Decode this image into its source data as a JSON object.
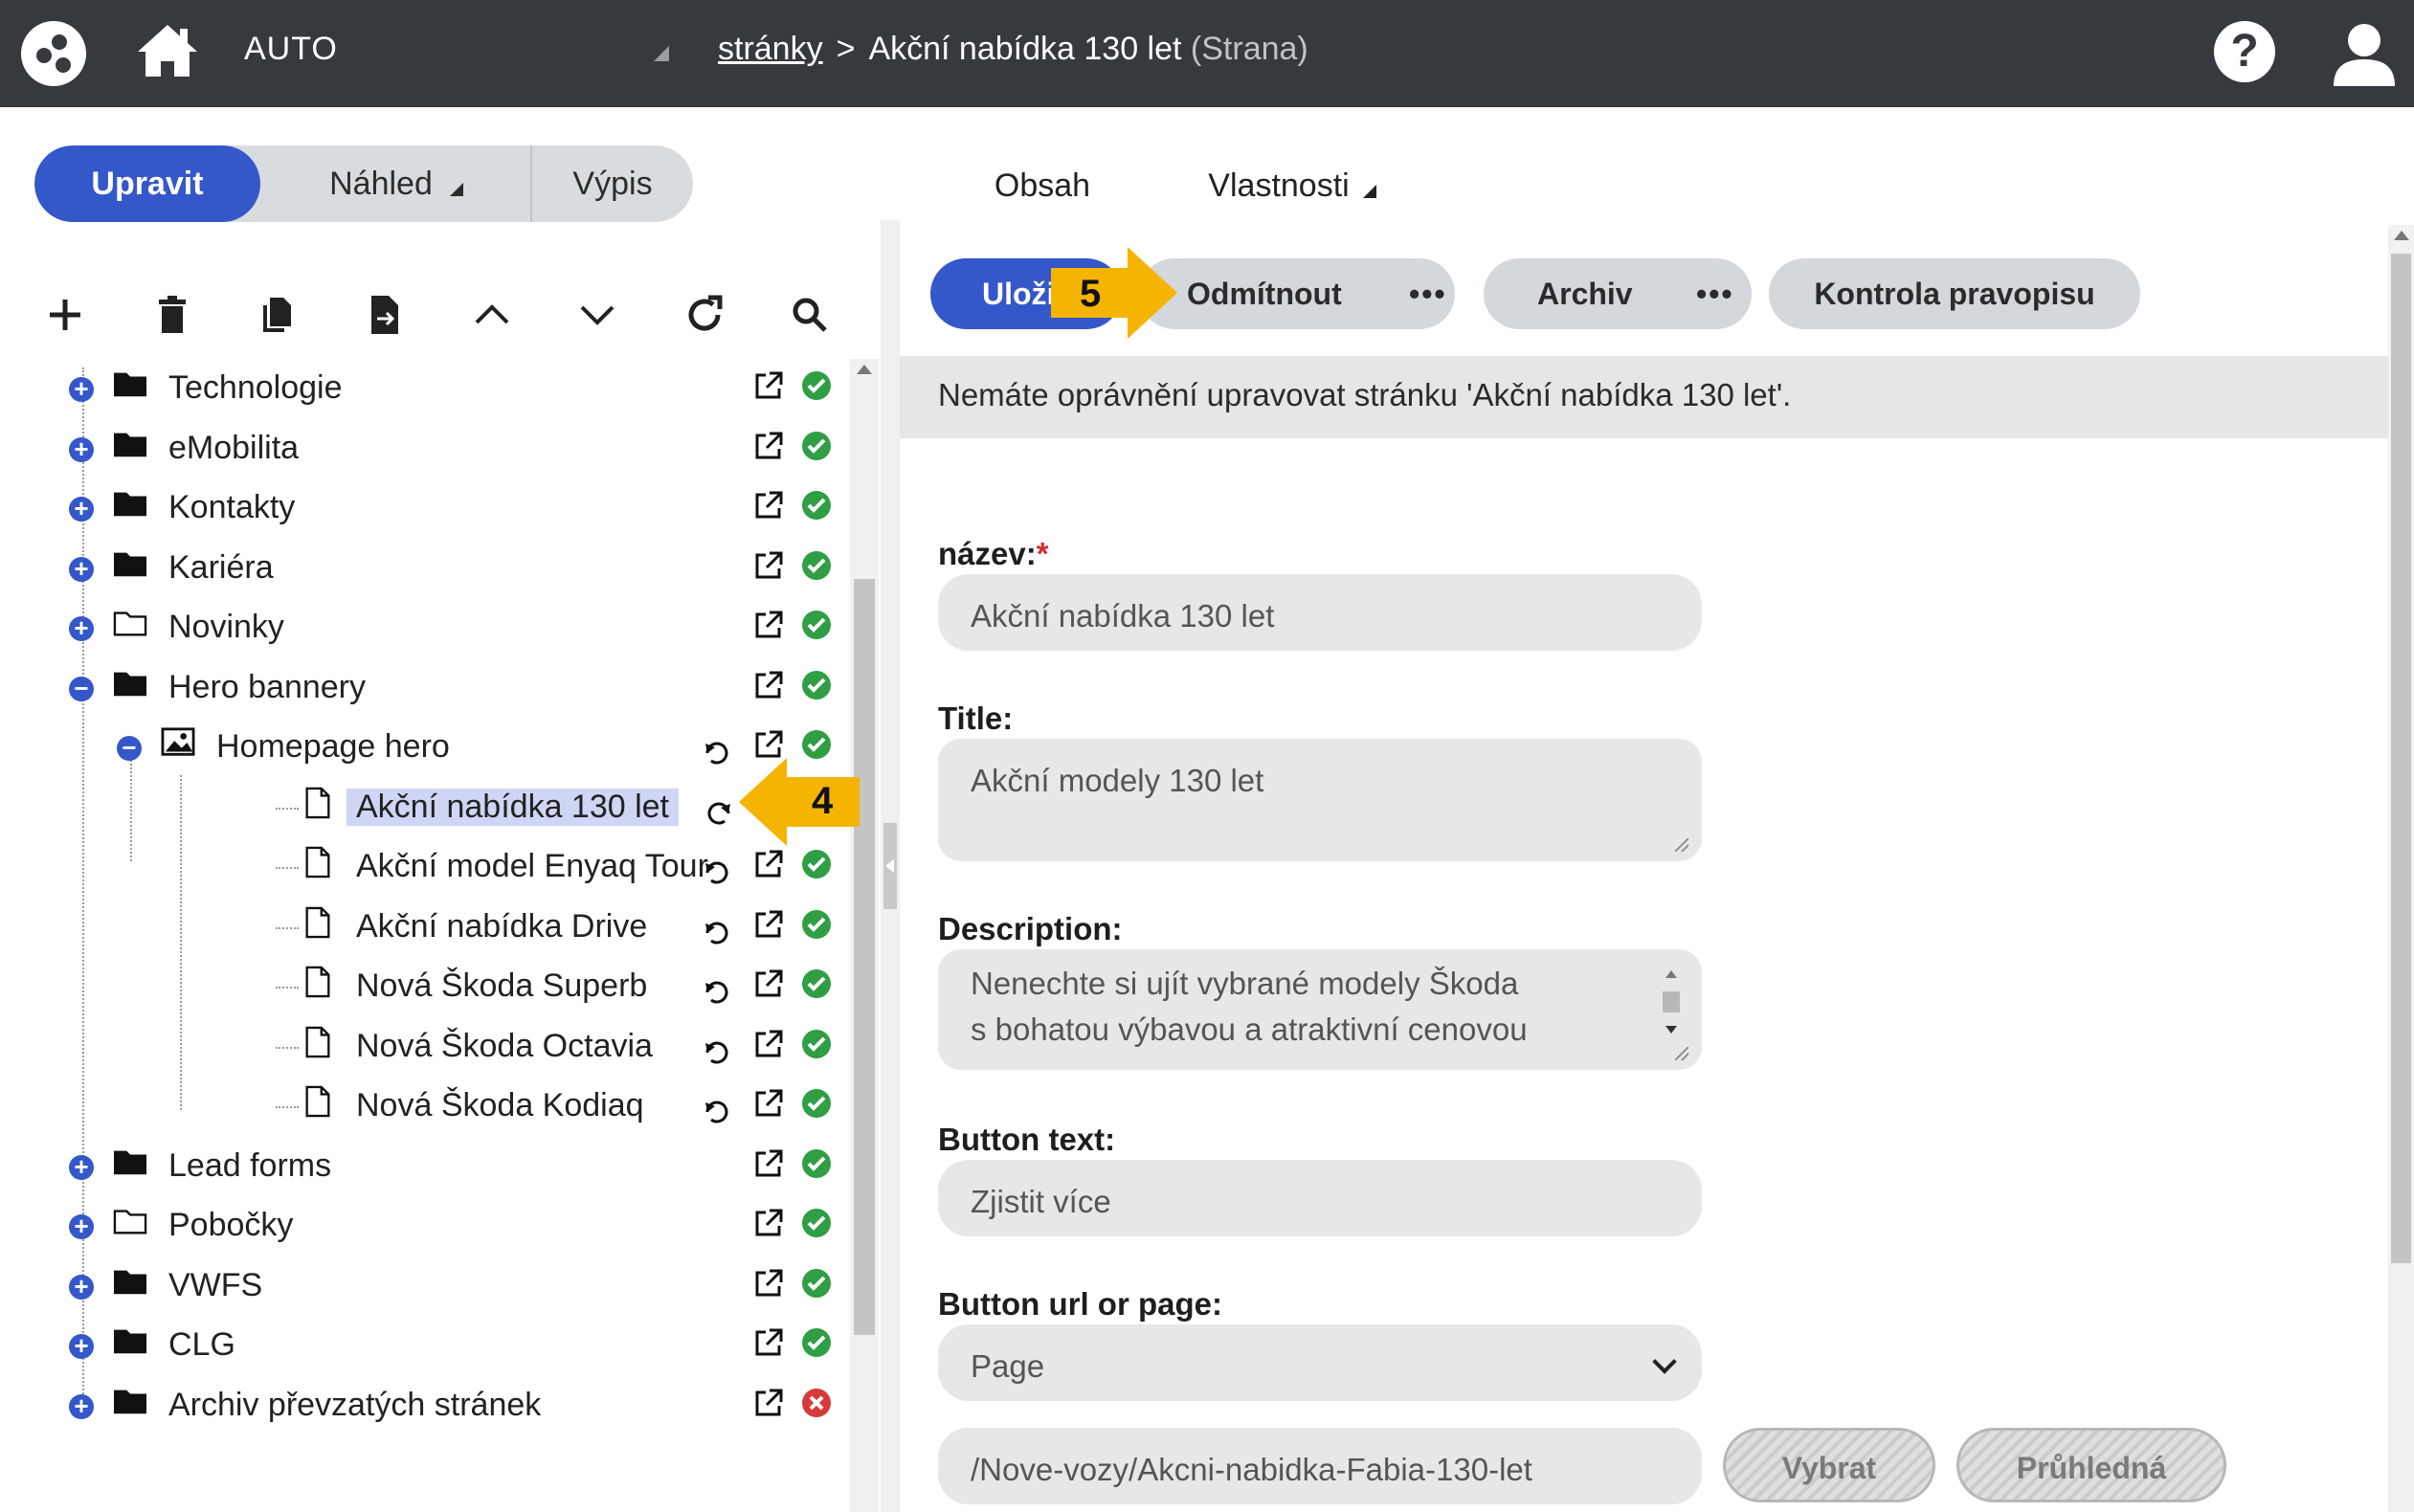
{
  "topbar": {
    "brand": "AUTO",
    "breadcrumb_link": "stránky",
    "breadcrumb_separator": ">",
    "breadcrumb_current": "Akční nabídka 130 let",
    "breadcrumb_type": "(Strana)",
    "help_label": "?"
  },
  "modes": {
    "edit": "Upravit",
    "preview": "Náhled",
    "list": "Výpis"
  },
  "toolbar_icons": [
    "add-icon",
    "delete-icon",
    "copy-icon",
    "move-icon",
    "move-up-icon",
    "move-down-icon",
    "refresh-icon",
    "search-icon"
  ],
  "tree": [
    {
      "label": "Technologie",
      "expander": "+",
      "icon": "folder-icon",
      "status": "ok"
    },
    {
      "label": "eMobilita",
      "expander": "+",
      "icon": "folder-icon",
      "status": "ok"
    },
    {
      "label": "Kontakty",
      "expander": "+",
      "icon": "folder-icon",
      "status": "ok"
    },
    {
      "label": "Kariéra",
      "expander": "+",
      "icon": "folder-icon",
      "status": "ok"
    },
    {
      "label": "Novinky",
      "expander": "+",
      "icon": "folder-outline-icon",
      "status": "ok"
    },
    {
      "label": "Hero bannery",
      "expander": "−",
      "icon": "folder-icon",
      "status": "ok"
    },
    {
      "label": "Homepage hero",
      "expander": "−",
      "icon": "image-icon",
      "status": "ok"
    },
    {
      "label": "Akční nabídka 130 let",
      "icon": "page-icon",
      "status": "none",
      "selected": true
    },
    {
      "label": "Akční model Enyaq Tour",
      "icon": "page-icon",
      "status": "ok"
    },
    {
      "label": "Akční nabídka Drive",
      "icon": "page-icon",
      "status": "ok"
    },
    {
      "label": "Nová Škoda Superb",
      "icon": "page-icon",
      "status": "ok"
    },
    {
      "label": "Nová Škoda Octavia",
      "icon": "page-icon",
      "status": "ok"
    },
    {
      "label": "Nová Škoda Kodiaq",
      "icon": "page-icon",
      "status": "ok"
    },
    {
      "label": "Lead forms",
      "expander": "+",
      "icon": "folder-icon",
      "status": "ok"
    },
    {
      "label": "Pobočky",
      "expander": "+",
      "icon": "folder-outline-icon",
      "status": "ok"
    },
    {
      "label": "VWFS",
      "expander": "+",
      "icon": "folder-icon",
      "status": "ok"
    },
    {
      "label": "CLG",
      "expander": "+",
      "icon": "folder-icon",
      "status": "ok"
    },
    {
      "label": "Archiv převzatých stránek",
      "expander": "+",
      "icon": "folder-icon",
      "status": "error"
    }
  ],
  "tabs": {
    "content": "Obsah",
    "properties": "Vlastnosti"
  },
  "actions": {
    "save": "Uloži",
    "reject": "Odmítnout",
    "archive": "Archiv",
    "more": "•••",
    "spellcheck": "Kontrola pravopisu"
  },
  "notice": "Nemáte oprávnění upravovat stránku 'Akční nabídka 130 let'.",
  "form": {
    "name_label": "název:",
    "name_required": "*",
    "name_value": "Akční nabídka 130 let",
    "title_label": "Title:",
    "title_value": "Akční modely 130 let",
    "description_label": "Description:",
    "description_value": "Nenechte si ujít vybrané modely Škoda\ns bohatou výbavou a atraktivní cenovou",
    "button_text_label": "Button text:",
    "button_text_value": "Zjistit více",
    "button_url_label": "Button url or page:",
    "button_url_select": "Page",
    "url_value": "/Nove-vozy/Akcni-nabidka-Fabia-130-let",
    "select_button": "Vybrat",
    "transparent_button": "Průhledná"
  },
  "callouts": {
    "step4": "4",
    "step5": "5",
    "color": "#f5b400"
  },
  "colors": {
    "topbar": "#36393d",
    "accent": "#3457c9",
    "ok": "#2f9e44",
    "error": "#d83a3a"
  }
}
